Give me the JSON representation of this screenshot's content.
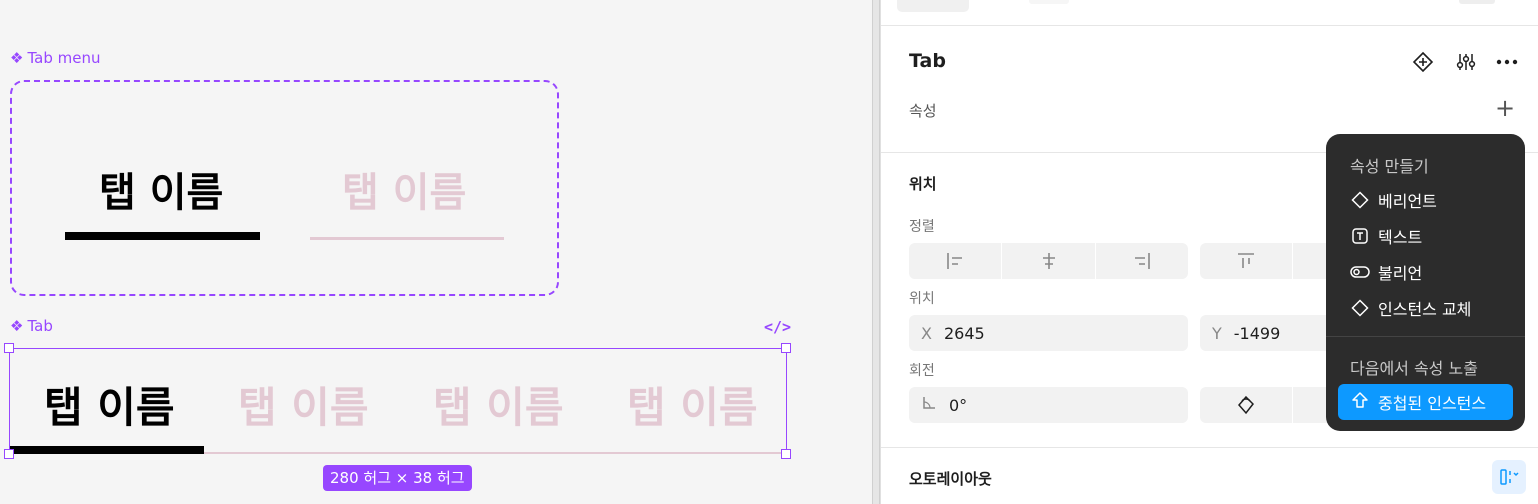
{
  "canvas": {
    "tabmenu_label": "Tab menu",
    "tab_label": "Tab",
    "tab_name": "탭 이름",
    "size_badge": "280 허그 × 38 허그"
  },
  "panel": {
    "title": "Tab",
    "properties_label": "속성",
    "position_section": "위치",
    "align_label": "정렬",
    "position_label": "위치",
    "x_label": "X",
    "x_value": "2645",
    "y_label": "Y",
    "y_value": "-1499",
    "rotation_label": "회전",
    "rotation_value": "0°",
    "autolayout_label": "오토레이아웃"
  },
  "popup": {
    "create_header": "속성 만들기",
    "items": [
      {
        "label": "베리언트",
        "icon": "diamond-icon"
      },
      {
        "label": "텍스트",
        "icon": "text-icon"
      },
      {
        "label": "불리언",
        "icon": "toggle-icon"
      },
      {
        "label": "인스턴스 교체",
        "icon": "diamond-icon"
      }
    ],
    "expose_header": "다음에서 속성 노출",
    "nested_button": "중첩된 인스턴스"
  },
  "colors": {
    "accent": "#9747ff",
    "inactive_tab": "#e3c9d3",
    "primary_blue": "#0d99ff",
    "popup_bg": "#2c2c2c"
  }
}
